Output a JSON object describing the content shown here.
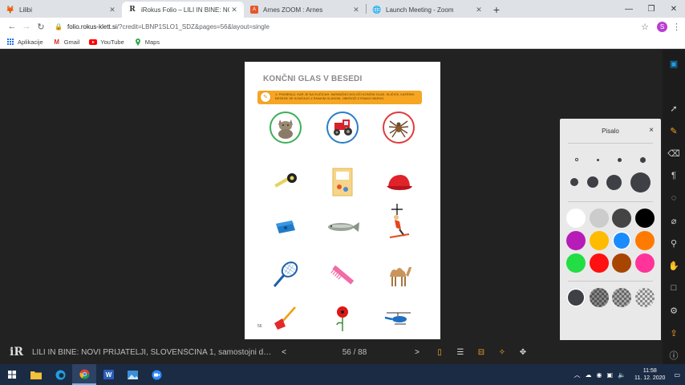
{
  "browser": {
    "tabs": [
      {
        "title": "Lilibi",
        "active": false,
        "favicon": "fox-icon"
      },
      {
        "title": "iRokus Folio – LILI IN BINE: NOVI",
        "active": true,
        "favicon": "rokus-icon"
      },
      {
        "title": "Arnes ZOOM : Arnes",
        "active": false,
        "favicon": "arnes-icon"
      },
      {
        "title": "Launch Meeting - Zoom",
        "active": false,
        "favicon": "globe-icon"
      }
    ],
    "new_tab": "+",
    "url_host": "folio.rokus-klett.si",
    "url_path": "/?credit=LBNP1SLO1_SDZ&pages=56&layout=single",
    "profile_initial": "S",
    "bookmarks": [
      {
        "label": "Aplikacije",
        "icon": "apps-grid-icon"
      },
      {
        "label": "Gmail",
        "icon": "gmail-icon"
      },
      {
        "label": "YouTube",
        "icon": "youtube-icon"
      },
      {
        "label": "Maps",
        "icon": "maps-icon"
      }
    ]
  },
  "page": {
    "title": "KONČNI GLAS V BESEDI",
    "instruction": "1. POIMENUJ, KAR JE NA SLIČICAH. NATANČNO DOLOČI KONČNI GLAS. SLIČICE, KATERIH BESEDE SE KONČAJO Z ENAKIM GLASOM, OBKROŽI Z ENAKO BARVO.",
    "page_number": "56"
  },
  "pisalo": {
    "title": "Pisalo",
    "close": "×",
    "colors": [
      "#ffffff",
      "#cccccc",
      "#444444",
      "#000000",
      "#b81cb8",
      "#ffbb00",
      "#1a8cff",
      "#ff7a00",
      "#22dd44",
      "#ff1111",
      "#a84500",
      "#ff3399"
    ]
  },
  "bottom_bar": {
    "book_title": "LILI IN BINE: NOVI PRIJATELJI, SLOVENŠČINA 1, samostojni delovni...",
    "page_counter": "56 / 88",
    "prev": "<",
    "next": ">"
  },
  "taskbar": {
    "time": "11:58",
    "date": "11. 12. 2020"
  },
  "colors": {
    "accent": "#f6a623",
    "ring_green": "#3fae5a",
    "ring_blue": "#2a7ec9",
    "ring_red": "#e23b3b"
  }
}
